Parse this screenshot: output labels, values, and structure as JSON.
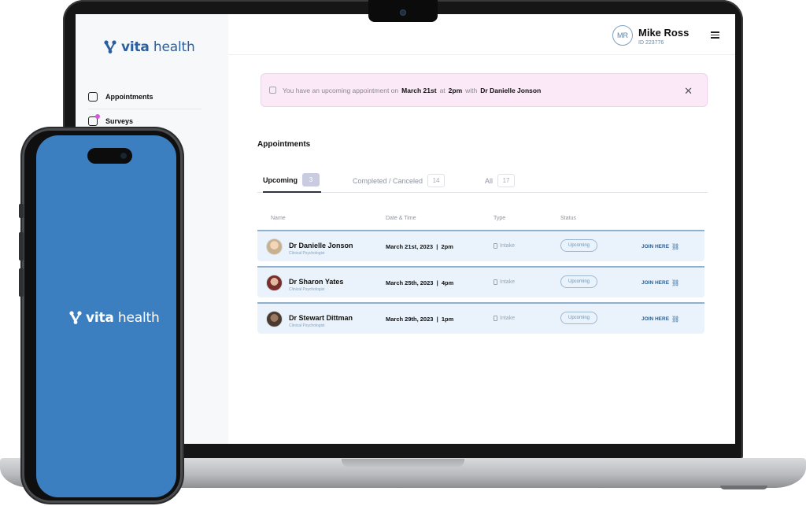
{
  "brand": {
    "name_bold": "vita",
    "name_rest": " health"
  },
  "colors": {
    "brand_blue": "#2b5f9e",
    "phone_bg": "#3c7fc1",
    "alert_bg": "#fbe9f8",
    "row_bg": "#eaf3fb",
    "survey_dot": "#d45ad8"
  },
  "sidebar": {
    "items": [
      {
        "label": "Appointments",
        "icon": "calendar-clock-icon"
      },
      {
        "label": "Surveys",
        "icon": "survey-icon"
      }
    ]
  },
  "user": {
    "initials": "MR",
    "name": "Mike Ross",
    "id": "ID 223776"
  },
  "alert": {
    "prefix": "You have an upcoming appointment on",
    "date": "March 21st",
    "at": "at",
    "time": "2pm",
    "with": "with",
    "doctor": "Dr Danielle Jonson",
    "close": "✕"
  },
  "appointments": {
    "title": "Appointments",
    "tabs": [
      {
        "label": "Upcoming",
        "count": "3"
      },
      {
        "label": "Completed / Canceled",
        "count": "14"
      },
      {
        "label": "All",
        "count": "17"
      }
    ],
    "columns": [
      "Name",
      "Date & Time",
      "Type",
      "Status"
    ],
    "rows": [
      {
        "name": "Dr Danielle Jonson",
        "specialty": "Clinical Psychologist",
        "date": "March 21st, 2023",
        "time": "2pm",
        "type": "Intake",
        "status": "Upcoming",
        "action": "JOIN HERE",
        "photo_color": "#c9b08e"
      },
      {
        "name": "Dr Sharon Yates",
        "specialty": "Clinical Psychologist",
        "date": "March 25th, 2023",
        "time": "4pm",
        "type": "Intake",
        "status": "Upcoming",
        "action": "JOIN HERE",
        "photo_color": "#7a2e2b"
      },
      {
        "name": "Dr Stewart Dittman",
        "specialty": "Clinical Psychologist",
        "date": "March 29th, 2023",
        "time": "1pm",
        "type": "Intake",
        "status": "Upcoming",
        "action": "JOIN HERE",
        "photo_color": "#6b5443"
      }
    ]
  },
  "phone": {
    "logo_bold": "vita",
    "logo_rest": " health"
  }
}
